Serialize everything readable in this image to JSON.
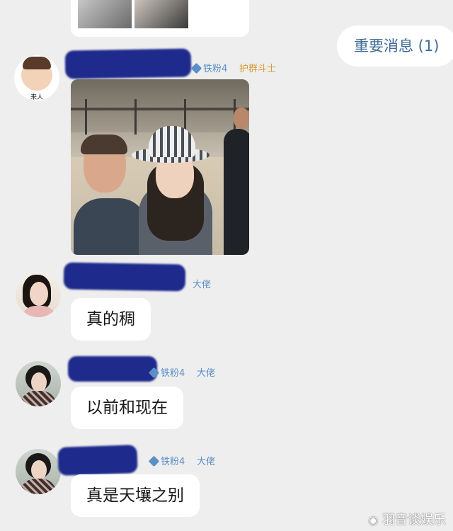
{
  "notice": {
    "label": "重要消息 (1)"
  },
  "messages": [
    {
      "badge": "铁粉4",
      "title": "护群斗士",
      "avatar_caption": "来人",
      "type": "image"
    },
    {
      "badge": "",
      "title": "大佬",
      "text": "真的稠",
      "type": "text"
    },
    {
      "badge": "铁粉4",
      "title": "大佬",
      "text": "以前和现在",
      "type": "text"
    },
    {
      "badge": "铁粉4",
      "title": "大佬",
      "text": "真是天壤之别",
      "type": "text"
    }
  ],
  "watermark": {
    "text": "羽音谈娱乐"
  },
  "colors": {
    "background": "#eeeeee",
    "redaction": "#1e2a8c",
    "badge": "#5a8fc7",
    "title_gold": "#d89a34",
    "notice_text": "#3f6b96"
  }
}
